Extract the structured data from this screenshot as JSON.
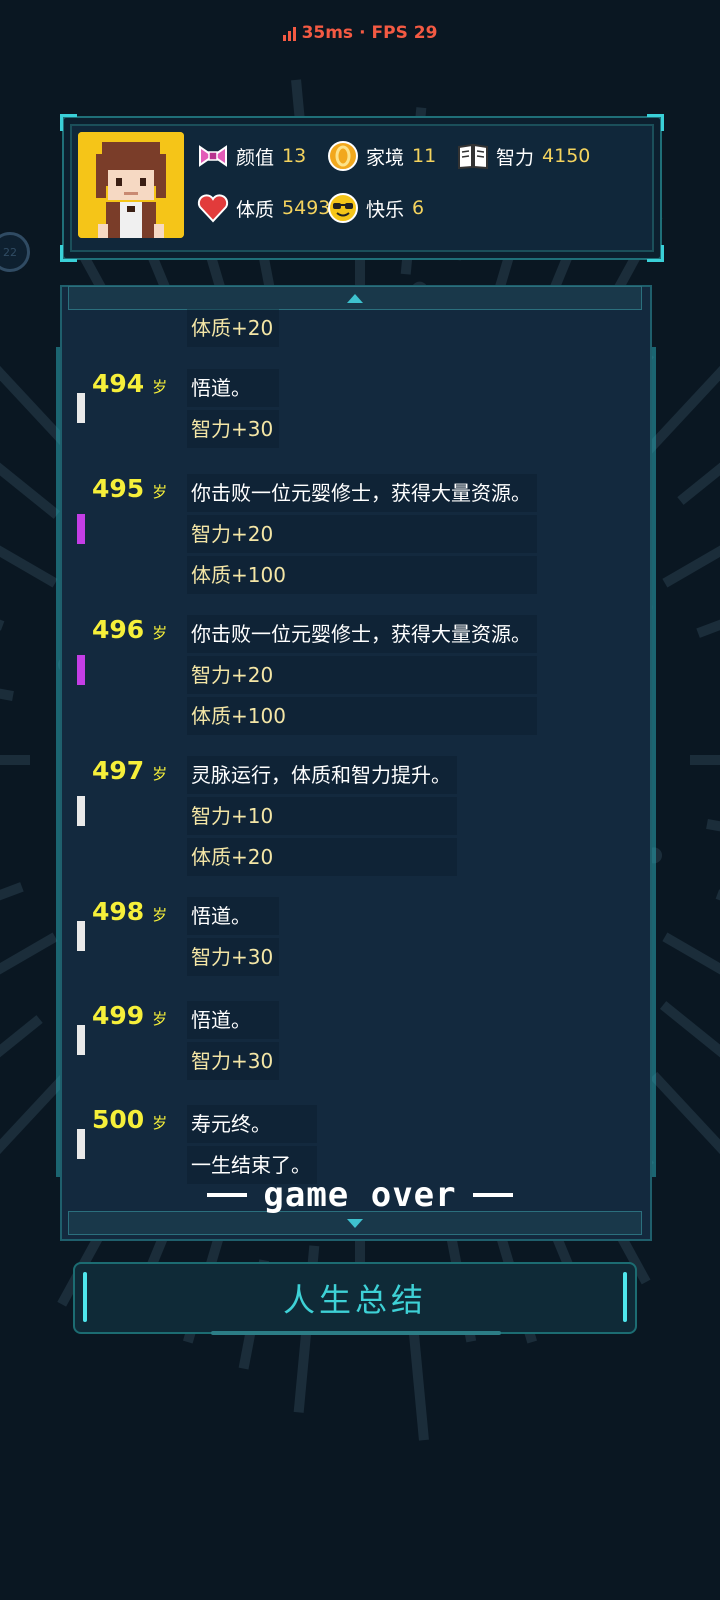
{
  "status": {
    "ping": "35ms",
    "separator": "·",
    "fps": "FPS 29"
  },
  "side_bubble": "22",
  "stats": [
    {
      "icon": "bow-icon",
      "label": "颜值",
      "value": "13"
    },
    {
      "icon": "coin-icon",
      "label": "家境",
      "value": "11"
    },
    {
      "icon": "book-icon",
      "label": "智力",
      "value": "4150"
    },
    {
      "icon": "heart-icon",
      "label": "体质",
      "value": "5493"
    },
    {
      "icon": "sunglasses-face-icon",
      "label": "快乐",
      "value": "6"
    }
  ],
  "log": {
    "age_unit": "岁",
    "partial_top": "体质+20",
    "entries": [
      {
        "age": "494",
        "grade": "white",
        "text": "悟道。",
        "effects": [
          "智力+30"
        ]
      },
      {
        "age": "495",
        "grade": "purple",
        "text": "你击败一位元婴修士，获得大量资源。",
        "effects": [
          "智力+20",
          "体质+100"
        ]
      },
      {
        "age": "496",
        "grade": "purple",
        "text": "你击败一位元婴修士，获得大量资源。",
        "effects": [
          "智力+20",
          "体质+100"
        ]
      },
      {
        "age": "497",
        "grade": "white",
        "text": "灵脉运行，体质和智力提升。",
        "effects": [
          "智力+10",
          "体质+20"
        ]
      },
      {
        "age": "498",
        "grade": "white",
        "text": "悟道。",
        "effects": [
          "智力+30"
        ]
      },
      {
        "age": "499",
        "grade": "white",
        "text": "悟道。",
        "effects": [
          "智力+30"
        ]
      },
      {
        "age": "500",
        "grade": "white",
        "text": "寿元终。",
        "effects": [
          "一生结束了。"
        ]
      }
    ]
  },
  "game_over": "game over",
  "summary_button": "人生总结",
  "colors": {
    "accent": "#3ed1d6",
    "age": "#f6ef3a",
    "grade_white": "#e9e9e9",
    "grade_purple": "#c43ee6",
    "ping": "#f45a43"
  }
}
